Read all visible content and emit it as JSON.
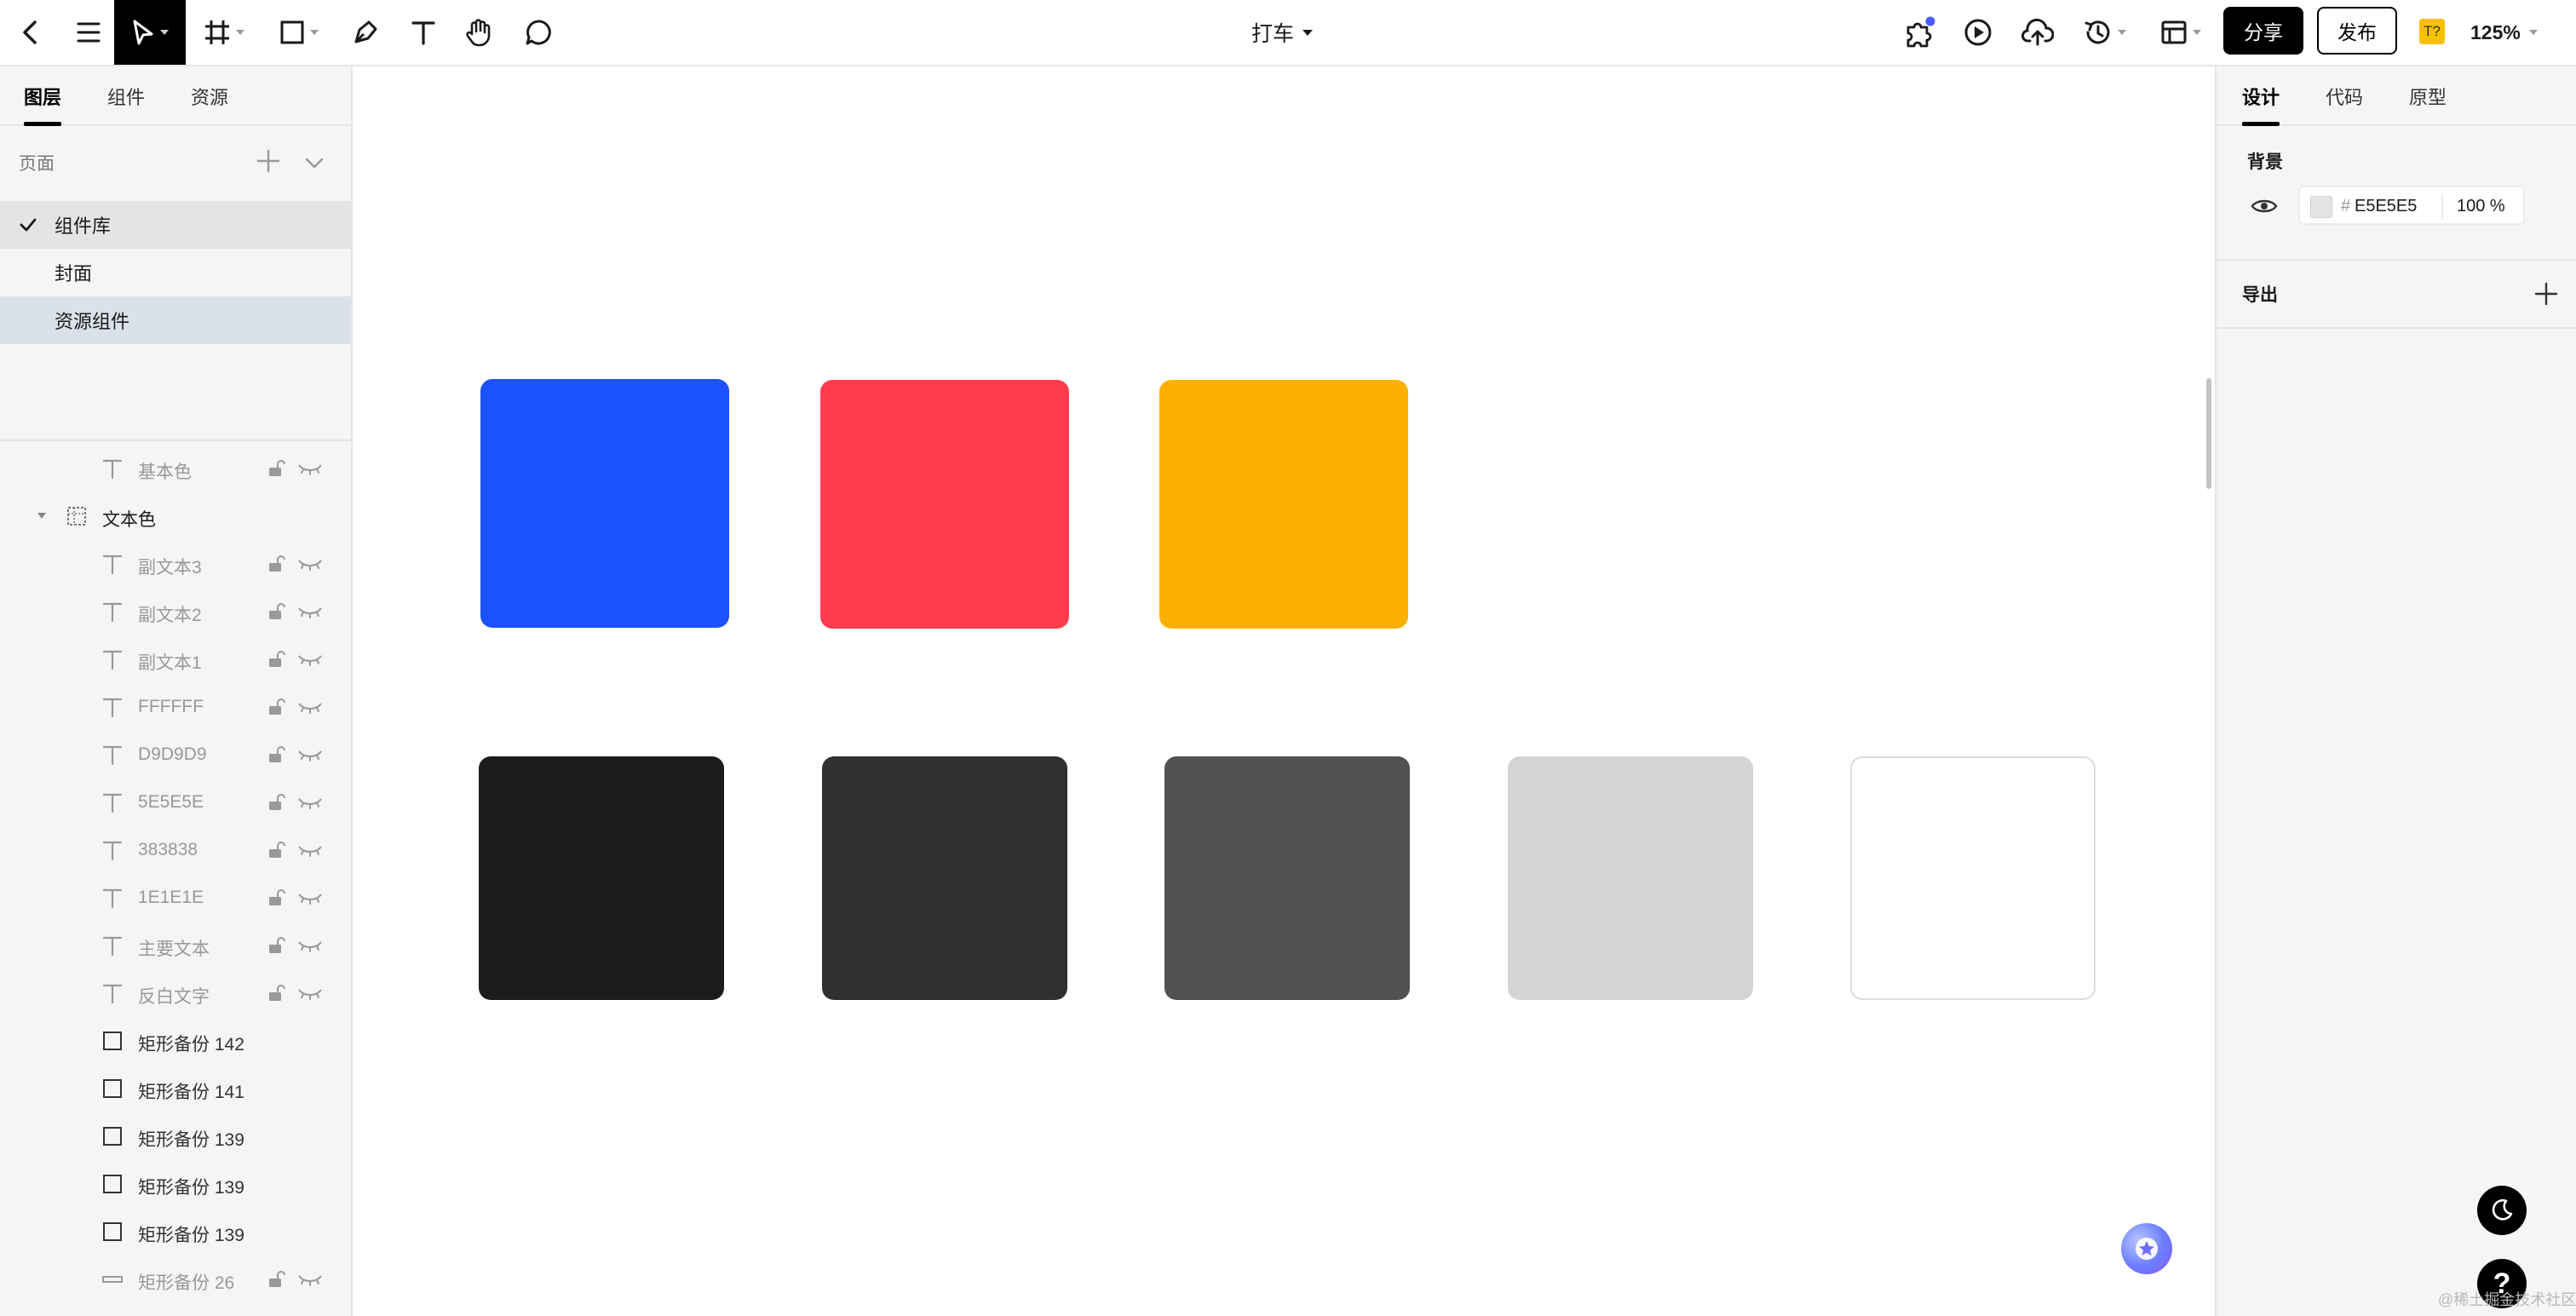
{
  "toolbar": {
    "doc_title": "打车",
    "share_label": "分享",
    "publish_label": "发布",
    "plugin_badge": "T?",
    "zoom": "125%",
    "icons": [
      "back-icon",
      "menu-icon",
      "move-tool-icon",
      "frame-tool-icon",
      "rectangle-tool-icon",
      "pen-tool-icon",
      "text-tool-icon",
      "hand-tool-icon",
      "comment-tool-icon",
      "plugin-icon",
      "play-icon",
      "upload-icon",
      "history-icon",
      "layout-icon"
    ]
  },
  "left_panel": {
    "tabs": [
      "图层",
      "组件",
      "资源"
    ],
    "active_tab": "图层",
    "pages_label": "页面",
    "pages": [
      {
        "label": "组件库",
        "state": "current"
      },
      {
        "label": "封面",
        "state": "normal"
      },
      {
        "label": "资源组件",
        "state": "selected"
      }
    ],
    "layers": [
      {
        "label": "基本色",
        "type": "text",
        "indent": 2,
        "muted": true
      },
      {
        "label": "文本色",
        "type": "frame",
        "indent": 1,
        "muted": false
      },
      {
        "label": "副文本3",
        "type": "text",
        "indent": 2,
        "muted": true
      },
      {
        "label": "副文本2",
        "type": "text",
        "indent": 2,
        "muted": true
      },
      {
        "label": "副文本1",
        "type": "text",
        "indent": 2,
        "muted": true
      },
      {
        "label": "FFFFFF",
        "type": "text",
        "indent": 2,
        "muted": true
      },
      {
        "label": "D9D9D9",
        "type": "text",
        "indent": 2,
        "muted": true
      },
      {
        "label": "5E5E5E",
        "type": "text",
        "indent": 2,
        "muted": true
      },
      {
        "label": "383838",
        "type": "text",
        "indent": 2,
        "muted": true
      },
      {
        "label": "1E1E1E",
        "type": "text",
        "indent": 2,
        "muted": true
      },
      {
        "label": "主要文本",
        "type": "text",
        "indent": 2,
        "muted": true
      },
      {
        "label": "反白文字",
        "type": "text",
        "indent": 2,
        "muted": true
      },
      {
        "label": "矩形备份 142",
        "type": "rect",
        "indent": 2,
        "muted": false
      },
      {
        "label": "矩形备份 141",
        "type": "rect",
        "indent": 2,
        "muted": false
      },
      {
        "label": "矩形备份 139",
        "type": "rect",
        "indent": 2,
        "muted": false
      },
      {
        "label": "矩形备份 139",
        "type": "rect",
        "indent": 2,
        "muted": false
      },
      {
        "label": "矩形备份 139",
        "type": "rect",
        "indent": 2,
        "muted": false
      },
      {
        "label": "矩形备份 26",
        "type": "line",
        "indent": 2,
        "muted": true
      }
    ]
  },
  "canvas": {
    "swatch_colors": [
      "#1b52fd",
      "#ff3c4e",
      "#fdb001",
      "#1c1c1c",
      "#303030",
      "#515151",
      "#d4d4d4",
      "#ffffff"
    ]
  },
  "right_panel": {
    "tabs": [
      "设计",
      "代码",
      "原型"
    ],
    "active_tab": "设计",
    "background": {
      "title": "背景",
      "hash": "#",
      "hex": "E5E5E5",
      "opacity": "100 %"
    },
    "export_title": "导出"
  },
  "help_label": "?",
  "watermark": "@稀土掘金技术社区"
}
